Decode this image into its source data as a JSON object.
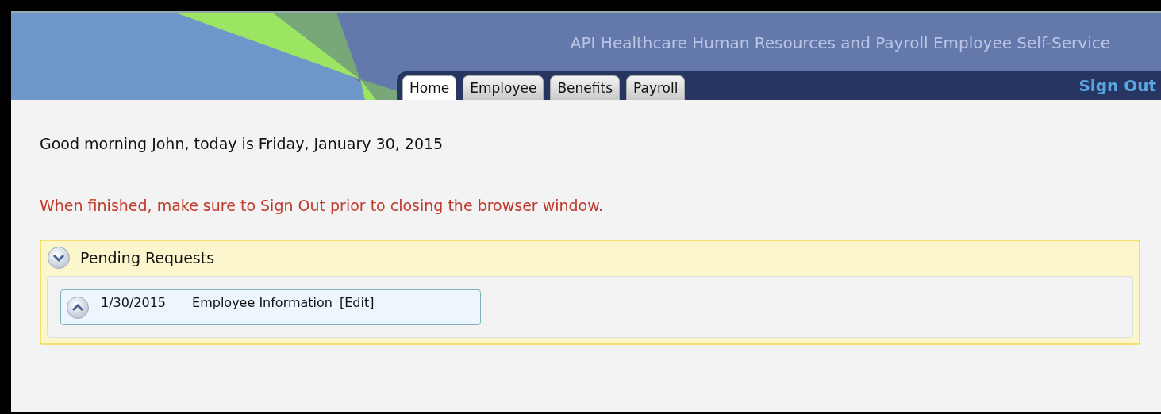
{
  "header": {
    "title": "API Healthcare Human Resources and Payroll Employee Self-Service",
    "sign_out": "Sign Out"
  },
  "tabs": [
    {
      "label": "Home",
      "selected": true
    },
    {
      "label": "Employee",
      "selected": false
    },
    {
      "label": "Benefits",
      "selected": false
    },
    {
      "label": "Payroll",
      "selected": false
    }
  ],
  "greeting": "Good morning John, today is Friday, January 30, 2015",
  "warning": "When finished, make sure to Sign Out prior to closing the browser window.",
  "pending_requests": {
    "title": "Pending Requests",
    "requests": [
      {
        "date": "1/30/2015",
        "description": "Employee Information",
        "action": "[Edit]"
      }
    ]
  }
}
